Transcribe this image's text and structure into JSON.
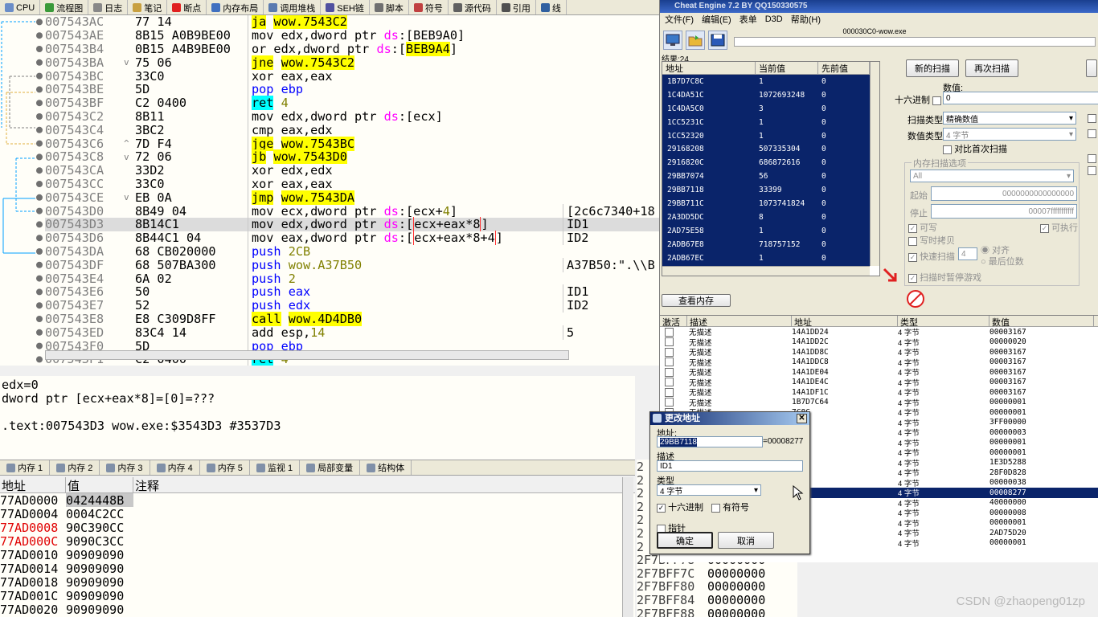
{
  "dbg_tabs": [
    {
      "label": "CPU",
      "icon": "cpu-icon",
      "color": "#6a8dc8"
    },
    {
      "label": "流程图",
      "icon": "graph-icon",
      "color": "#3a9a3a"
    },
    {
      "label": "日志",
      "icon": "log-icon",
      "color": "#888888"
    },
    {
      "label": "笔记",
      "icon": "notes-icon",
      "color": "#c8a040"
    },
    {
      "label": "断点",
      "icon": "breakpoint-icon",
      "color": "#e02020"
    },
    {
      "label": "内存布局",
      "icon": "memory-map-icon",
      "color": "#4070c0"
    },
    {
      "label": "调用堆栈",
      "icon": "call-stack-icon",
      "color": "#5a7ab0"
    },
    {
      "label": "SEH链",
      "icon": "seh-icon",
      "color": "#5050a0"
    },
    {
      "label": "脚本",
      "icon": "script-icon",
      "color": "#707070"
    },
    {
      "label": "符号",
      "icon": "symbol-icon",
      "color": "#c04040"
    },
    {
      "label": "源代码",
      "icon": "source-icon",
      "color": "#606060"
    },
    {
      "label": "引用",
      "icon": "reference-icon",
      "color": "#505050"
    },
    {
      "label": "线",
      "icon": "thread-icon",
      "color": "#3060a0"
    }
  ],
  "disasm": [
    {
      "addr": "007543AC",
      "arrow": "",
      "bytes": "77 14",
      "parts": [
        {
          "t": "ja",
          "c": "jmp"
        },
        {
          "t": " "
        },
        {
          "t": "wow.7543C2",
          "c": "jmp"
        }
      ],
      "cmt": ""
    },
    {
      "addr": "007543AE",
      "arrow": "",
      "bytes": "8B15 A0B9BE00",
      "parts": [
        {
          "t": "mov edx,dword ptr "
        },
        {
          "t": "ds",
          "c": "seg"
        },
        {
          "t": ":[BEB9A0]"
        }
      ],
      "cmt": ""
    },
    {
      "addr": "007543B4",
      "arrow": "",
      "bytes": "0B15 A4B9BE00",
      "parts": [
        {
          "t": "or edx,dword ptr "
        },
        {
          "t": "ds",
          "c": "seg"
        },
        {
          "t": ":["
        },
        {
          "t": "BEB9A4",
          "c": "jmp"
        },
        {
          "t": "]"
        }
      ],
      "cmt": ""
    },
    {
      "addr": "007543BA",
      "arrow": "v",
      "bytes": "75 06",
      "parts": [
        {
          "t": "jne",
          "c": "jmp"
        },
        {
          "t": " "
        },
        {
          "t": "wow.7543C2",
          "c": "jmp"
        }
      ],
      "cmt": ""
    },
    {
      "addr": "007543BC",
      "arrow": "",
      "bytes": "33C0",
      "parts": [
        {
          "t": "xor eax,eax"
        }
      ],
      "cmt": ""
    },
    {
      "addr": "007543BE",
      "arrow": "",
      "bytes": "5D",
      "parts": [
        {
          "t": "pop ebp",
          "c": "push"
        }
      ],
      "cmt": ""
    },
    {
      "addr": "007543BF",
      "arrow": "",
      "bytes": "C2 0400",
      "parts": [
        {
          "t": "ret",
          "c": "retk"
        },
        {
          "t": " "
        },
        {
          "t": "4",
          "c": "num"
        }
      ],
      "cmt": ""
    },
    {
      "addr": "007543C2",
      "arrow": "",
      "bytes": "8B11",
      "parts": [
        {
          "t": "mov edx,dword ptr "
        },
        {
          "t": "ds",
          "c": "seg"
        },
        {
          "t": ":[ecx]"
        }
      ],
      "cmt": ""
    },
    {
      "addr": "007543C4",
      "arrow": "",
      "bytes": "3BC2",
      "parts": [
        {
          "t": "cmp eax,edx"
        }
      ],
      "cmt": ""
    },
    {
      "addr": "007543C6",
      "arrow": "^",
      "bytes": "7D F4",
      "parts": [
        {
          "t": "jge",
          "c": "jmp"
        },
        {
          "t": " "
        },
        {
          "t": "wow.7543BC",
          "c": "jmp"
        }
      ],
      "cmt": ""
    },
    {
      "addr": "007543C8",
      "arrow": "v",
      "bytes": "72 06",
      "parts": [
        {
          "t": "jb",
          "c": "jmp"
        },
        {
          "t": " "
        },
        {
          "t": "wow.7543D0",
          "c": "jmp"
        }
      ],
      "cmt": ""
    },
    {
      "addr": "007543CA",
      "arrow": "",
      "bytes": "33D2",
      "parts": [
        {
          "t": "xor edx,edx"
        }
      ],
      "cmt": ""
    },
    {
      "addr": "007543CC",
      "arrow": "",
      "bytes": "33C0",
      "parts": [
        {
          "t": "xor eax,eax"
        }
      ],
      "cmt": ""
    },
    {
      "addr": "007543CE",
      "arrow": "v",
      "bytes": "EB 0A",
      "parts": [
        {
          "t": "jmp",
          "c": "jmp"
        },
        {
          "t": " "
        },
        {
          "t": "wow.7543DA",
          "c": "jmp"
        }
      ],
      "cmt": ""
    },
    {
      "addr": "007543D0",
      "arrow": "",
      "bytes": "8B49 04",
      "parts": [
        {
          "t": "mov ecx,dword ptr "
        },
        {
          "t": "ds",
          "c": "seg"
        },
        {
          "t": ":[ecx+"
        },
        {
          "t": "4",
          "c": "num"
        },
        {
          "t": "]"
        }
      ],
      "cmt": "[2c6c7340+18"
    },
    {
      "addr": "007543D3",
      "arrow": "",
      "bytes": "8B14C1",
      "parts": [
        {
          "t": "mov edx,dword ptr "
        },
        {
          "t": "ds",
          "c": "seg"
        },
        {
          "t": ":["
        },
        {
          "t": "ecx+eax*8",
          "c": "regbox"
        },
        {
          "t": "]"
        }
      ],
      "cmt": "ID1",
      "hl": true
    },
    {
      "addr": "007543D6",
      "arrow": "",
      "bytes": "8B44C1 04",
      "parts": [
        {
          "t": "mov eax,dword ptr "
        },
        {
          "t": "ds",
          "c": "seg"
        },
        {
          "t": ":["
        },
        {
          "t": "ecx+eax*8+4",
          "c": "regbox"
        },
        {
          "t": "]"
        }
      ],
      "cmt": "ID2"
    },
    {
      "addr": "007543DA",
      "arrow": "",
      "bytes": "68 CB020000",
      "parts": [
        {
          "t": "push ",
          "c": "push"
        },
        {
          "t": "2CB",
          "c": "num"
        }
      ],
      "cmt": ""
    },
    {
      "addr": "007543DF",
      "arrow": "",
      "bytes": "68 507BA300",
      "parts": [
        {
          "t": "push ",
          "c": "push"
        },
        {
          "t": "wow.A37B50",
          "c": "num"
        }
      ],
      "cmt": "A37B50:\".\\\\B"
    },
    {
      "addr": "007543E4",
      "arrow": "",
      "bytes": "6A 02",
      "parts": [
        {
          "t": "push ",
          "c": "push"
        },
        {
          "t": "2",
          "c": "num"
        }
      ],
      "cmt": ""
    },
    {
      "addr": "007543E6",
      "arrow": "",
      "bytes": "50",
      "parts": [
        {
          "t": "push eax",
          "c": "push"
        }
      ],
      "cmt": "ID1"
    },
    {
      "addr": "007543E7",
      "arrow": "",
      "bytes": "52",
      "parts": [
        {
          "t": "push edx",
          "c": "push"
        }
      ],
      "cmt": "ID2"
    },
    {
      "addr": "007543E8",
      "arrow": "",
      "bytes": "E8 C309D8FF",
      "parts": [
        {
          "t": "call",
          "c": "callk"
        },
        {
          "t": " "
        },
        {
          "t": "wow.4D4DB0",
          "c": "callk"
        }
      ],
      "cmt": ""
    },
    {
      "addr": "007543ED",
      "arrow": "",
      "bytes": "83C4 14",
      "parts": [
        {
          "t": "add esp,"
        },
        {
          "t": "14",
          "c": "num"
        }
      ],
      "cmt": "5"
    },
    {
      "addr": "007543F0",
      "arrow": "",
      "bytes": "5D",
      "parts": [
        {
          "t": "pop ebp",
          "c": "push"
        }
      ],
      "cmt": ""
    },
    {
      "addr": "007543F1",
      "arrow": "",
      "bytes": "C2 0400",
      "parts": [
        {
          "t": "ret",
          "c": "retk"
        },
        {
          "t": " "
        },
        {
          "t": "4",
          "c": "num"
        }
      ],
      "cmt": ""
    }
  ],
  "info_lines": [
    "edx=0",
    "dword ptr [ecx+eax*8]=[0]=???",
    "",
    ".text:007543D3 wow.exe:$3543D3 #3537D3"
  ],
  "dump_tabs": [
    {
      "label": "内存 1",
      "icon": "memory-icon"
    },
    {
      "label": "内存 2",
      "icon": "memory-icon"
    },
    {
      "label": "内存 3",
      "icon": "memory-icon"
    },
    {
      "label": "内存 4",
      "icon": "memory-icon"
    },
    {
      "label": "内存 5",
      "icon": "memory-icon"
    },
    {
      "label": "监视 1",
      "icon": "watch-icon"
    },
    {
      "label": "局部变量",
      "icon": "locals-icon"
    },
    {
      "label": "结构体",
      "icon": "struct-icon"
    }
  ],
  "dump_headers": {
    "addr": "地址",
    "value": "值",
    "comment": "注释"
  },
  "dump_rows": [
    {
      "addr": "77AD0000",
      "value": "0424448B",
      "red": false,
      "sel": true
    },
    {
      "addr": "77AD0004",
      "value": "0004C2CC",
      "red": false
    },
    {
      "addr": "77AD0008",
      "value": "90C390CC",
      "red": true
    },
    {
      "addr": "77AD000C",
      "value": "9090C3CC",
      "red": true
    },
    {
      "addr": "77AD0010",
      "value": "90909090",
      "red": false
    },
    {
      "addr": "77AD0014",
      "value": "90909090",
      "red": false
    },
    {
      "addr": "77AD0018",
      "value": "90909090",
      "red": false
    },
    {
      "addr": "77AD001C",
      "value": "90909090",
      "red": false
    },
    {
      "addr": "77AD0020",
      "value": "90909090",
      "red": false
    }
  ],
  "stack_rows": [
    {
      "a": "2",
      "v": ""
    },
    {
      "a": "2",
      "v": ""
    },
    {
      "a": "2",
      "v": ""
    },
    {
      "a": "2",
      "v": ""
    },
    {
      "a": "2",
      "v": ""
    },
    {
      "a": "2",
      "v": ""
    },
    {
      "a": "2",
      "v": ""
    },
    {
      "a": "2F7BFF78",
      "v": "00000000"
    },
    {
      "a": "2F7BFF7C",
      "v": "00000000"
    },
    {
      "a": "2F7BFF80",
      "v": "00000000"
    },
    {
      "a": "2F7BFF84",
      "v": "00000000"
    },
    {
      "a": "2F7BFF88",
      "v": "00000000"
    }
  ],
  "ce": {
    "title": "Cheat Engine 7.2 BY QQ150330575",
    "menu": [
      "文件(F)",
      "编辑(E)",
      "表单",
      "D3D",
      "帮助(H)"
    ],
    "process": "000030C0-wow.exe",
    "result_count": "结果:24",
    "result_headers": [
      "地址",
      "当前值",
      "先前值"
    ],
    "results": [
      {
        "a": "1B7D7C8C",
        "c": "1",
        "p": "0"
      },
      {
        "a": "1C4DA51C",
        "c": "1072693248",
        "p": "0"
      },
      {
        "a": "1C4DA5C0",
        "c": "3",
        "p": "0"
      },
      {
        "a": "1CC5231C",
        "c": "1",
        "p": "0"
      },
      {
        "a": "1CC52320",
        "c": "1",
        "p": "0"
      },
      {
        "a": "29168208",
        "c": "507335304",
        "p": "0"
      },
      {
        "a": "2916820C",
        "c": "686872616",
        "p": "0"
      },
      {
        "a": "29BB7074",
        "c": "56",
        "p": "0"
      },
      {
        "a": "29BB7118",
        "c": "33399",
        "p": "0"
      },
      {
        "a": "29BB711C",
        "c": "1073741824",
        "p": "0"
      },
      {
        "a": "2A3DD5DC",
        "c": "8",
        "p": "0"
      },
      {
        "a": "2AD75E58",
        "c": "1",
        "p": "0"
      },
      {
        "a": "2ADB67E8",
        "c": "718757152",
        "p": "0"
      },
      {
        "a": "2ADB67EC",
        "c": "1",
        "p": "0"
      }
    ],
    "new_scan": "新的扫描",
    "next_scan": "再次扫描",
    "value_label": "数值:",
    "hex_label": "十六进制",
    "value": "0",
    "scan_type_label": "扫描类型",
    "scan_type": "精确数值",
    "value_type_label": "数值类型",
    "value_type": "4 字节",
    "compare_first": "对比首次扫描",
    "mem_options": "内存扫描选项",
    "mem_region": "All",
    "start_label": "起始",
    "start": "0000000000000000",
    "stop_label": "停止",
    "stop": "00007fffffffffff",
    "writable": "可写",
    "executable": "可执行",
    "copy_on_write": "写时拷贝",
    "fast_scan": "快速扫描",
    "fast_scan_value": "4",
    "align": "对齐",
    "last_digits": "最后位数",
    "pause": "扫描时暂停游戏",
    "view_memory": "查看内存",
    "addr_headers": [
      "激活",
      "描述",
      "地址",
      "类型",
      "数值"
    ],
    "addr_rows": [
      {
        "d": "无描述",
        "ad": "14A1DD24",
        "t": "4 字节",
        "v": "00003167"
      },
      {
        "d": "无描述",
        "ad": "14A1DD2C",
        "t": "4 字节",
        "v": "00000020"
      },
      {
        "d": "无描述",
        "ad": "14A1DD8C",
        "t": "4 字节",
        "v": "00003167"
      },
      {
        "d": "无描述",
        "ad": "14A1DDC8",
        "t": "4 字节",
        "v": "00003167"
      },
      {
        "d": "无描述",
        "ad": "14A1DE04",
        "t": "4 字节",
        "v": "00003167"
      },
      {
        "d": "无描述",
        "ad": "14A1DE4C",
        "t": "4 字节",
        "v": "00003167"
      },
      {
        "d": "无描述",
        "ad": "14A1DF1C",
        "t": "4 字节",
        "v": "00003167"
      },
      {
        "d": "无描述",
        "ad": "1B7D7C64",
        "t": "4 字节",
        "v": "00000001"
      },
      {
        "d": "无描述",
        "ad": "7C8C",
        "t": "4 字节",
        "v": "00000001"
      },
      {
        "d": "",
        "ad": "A51C",
        "t": "4 字节",
        "v": "3FF00000"
      },
      {
        "d": "",
        "ad": "A5C0",
        "t": "4 字节",
        "v": "00000003"
      },
      {
        "d": "",
        "ad": "231C",
        "t": "4 字节",
        "v": "00000001"
      },
      {
        "d": "",
        "ad": "2320",
        "t": "4 字节",
        "v": "00000001"
      },
      {
        "d": "",
        "ad": "8208",
        "t": "4 字节",
        "v": "1E3D5288"
      },
      {
        "d": "",
        "ad": "820C",
        "t": "4 字节",
        "v": "28F0D828"
      },
      {
        "d": "",
        "ad": "7074",
        "t": "4 字节",
        "v": "00000038"
      },
      {
        "d": "",
        "ad": "7118",
        "t": "4 字节",
        "v": "00008277",
        "sel": true
      },
      {
        "d": "",
        "ad": "711C",
        "t": "4 字节",
        "v": "40000000"
      },
      {
        "d": "",
        "ad": "D5DC",
        "t": "4 字节",
        "v": "00000008"
      },
      {
        "d": "",
        "ad": "5E58",
        "t": "4 字节",
        "v": "00000001"
      },
      {
        "d": "",
        "ad": "67E8",
        "t": "4 字节",
        "v": "2AD75D20"
      },
      {
        "d": "",
        "ad": "67EC",
        "t": "4 字节",
        "v": "00000001"
      }
    ]
  },
  "dialog": {
    "title": "更改地址",
    "addr_label": "地址:",
    "addr": "29BB7118",
    "addr_result": "=00008277",
    "desc_label": "描述",
    "desc": "ID1",
    "type_label": "类型",
    "type": "4 字节",
    "hex_label": "十六进制",
    "signed_label": "有符号",
    "pointer_label": "指针",
    "ok": "确定",
    "cancel": "取消"
  },
  "watermark": "CSDN @zhaopeng01zp"
}
